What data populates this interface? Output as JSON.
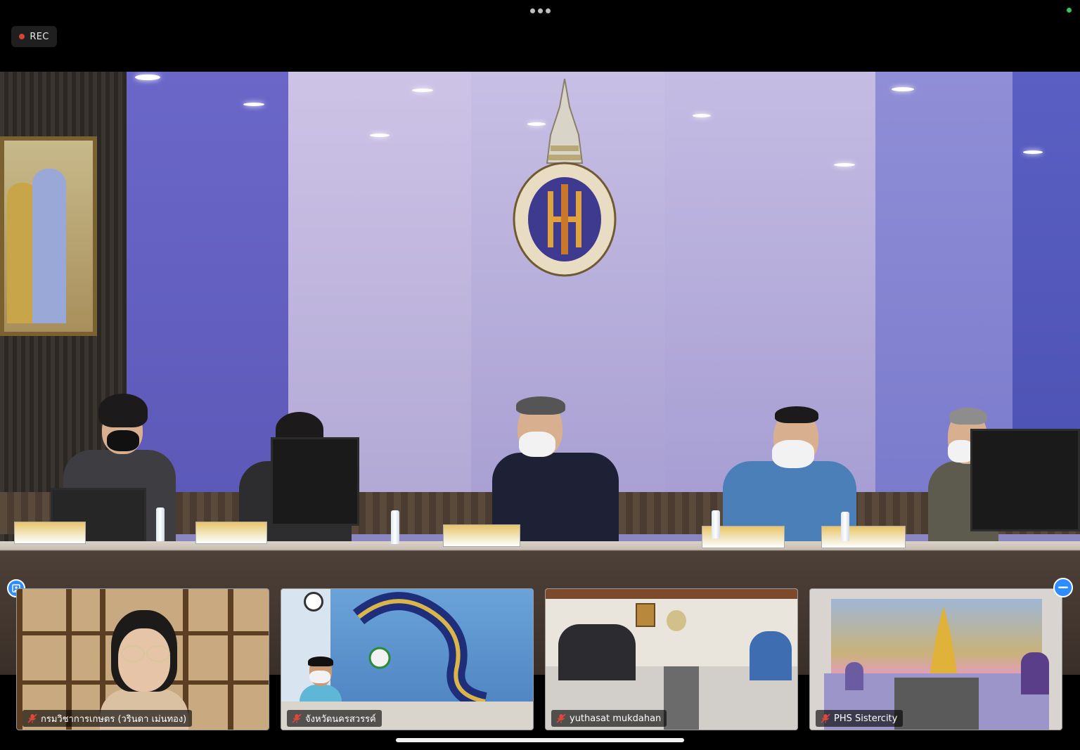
{
  "status_bar": {
    "more_icon": "ellipsis-icon",
    "camera_indicator_color": "#35c759"
  },
  "recording": {
    "label": "REC",
    "dot_color": "#d84333"
  },
  "main_video": {
    "icon": "active-speaker-video"
  },
  "participants": [
    {
      "name": "กรมวิชาการเกษตร (วรินดา เม่นทอง)",
      "muted": true
    },
    {
      "name": "จังหวัดนครสวรรค์",
      "muted": true
    },
    {
      "name": "yuthasat mukdahan",
      "muted": true
    },
    {
      "name": "PHS Sistercity",
      "muted": true
    }
  ],
  "controls": {
    "pin_icon": "pin-video-icon",
    "minimize_icon": "minimize-icon"
  },
  "colors": {
    "accent": "#2d8cff",
    "muted_mic": "#e0463a"
  }
}
